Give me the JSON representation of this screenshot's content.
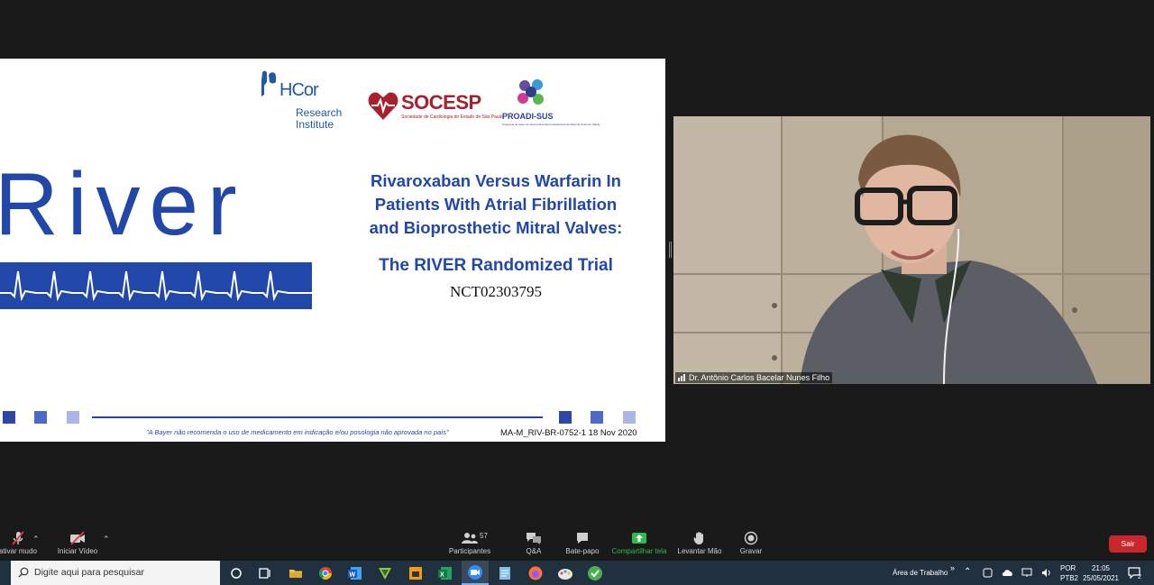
{
  "slide": {
    "logos": {
      "hcor_name": "HCor",
      "hcor_sub": "Research Institute",
      "socesp_name": "SOCESP",
      "socesp_sub": "Sociedade de Cardiologia do Estado de São Paulo",
      "proadi_name": "PROADI-SUS",
      "proadi_sub": "Programa de Apoio ao Desenvolvimento Institucional do Sistema Único de Saúde"
    },
    "river_word": "River",
    "title_lines": [
      "Rivaroxaban Versus Warfarin In",
      "Patients With Atrial Fibrillation",
      "and Bioprosthetic Mitral Valves:"
    ],
    "subtitle": "The RIVER Randomized Trial",
    "nct": "NCT02303795",
    "disclaimer": "\"A Bayer não recomenda o uso de medicamento em indicação e/ou posologia não aprovada no país\"",
    "code": "MA-M_RIV-BR-0752-1   18 Nov 2020",
    "colors": {
      "brand_blue": "#2147a8",
      "socesp_red": "#a8202d"
    }
  },
  "video": {
    "participant_name": "Dr. Antônio Carlos Bacelar Nunes Filho"
  },
  "toolbar": {
    "mute_label": "ativar mudo",
    "video_label": "Iniciar Vídeo",
    "participants_label": "Participantes",
    "participants_count": "57",
    "qa_label": "Q&A",
    "chat_label": "Bate-papo",
    "share_label": "Compartilhar tela",
    "raise_hand_label": "Levantar Mão",
    "record_label": "Gravar",
    "leave_label": "Sair",
    "colors": {
      "share_green": "#2dbb4d",
      "leave_red": "#c9272b"
    }
  },
  "taskbar": {
    "search_placeholder": "Digite aqui para pesquisar",
    "desktop_label": "Área de Trabalho",
    "lang_line1": "POR",
    "lang_line2": "PTB2",
    "time": "21:05",
    "date": "25/05/2021",
    "notification_count": "2",
    "apps": [
      "cortana-icon",
      "task-view-icon",
      "file-explorer-icon",
      "chrome-icon",
      "word-icon",
      "winrar-icon",
      "ppt-icon",
      "excel-icon",
      "zoom-icon",
      "notepad-icon",
      "firefox-icon",
      "paint-icon",
      "green-app-icon"
    ]
  }
}
